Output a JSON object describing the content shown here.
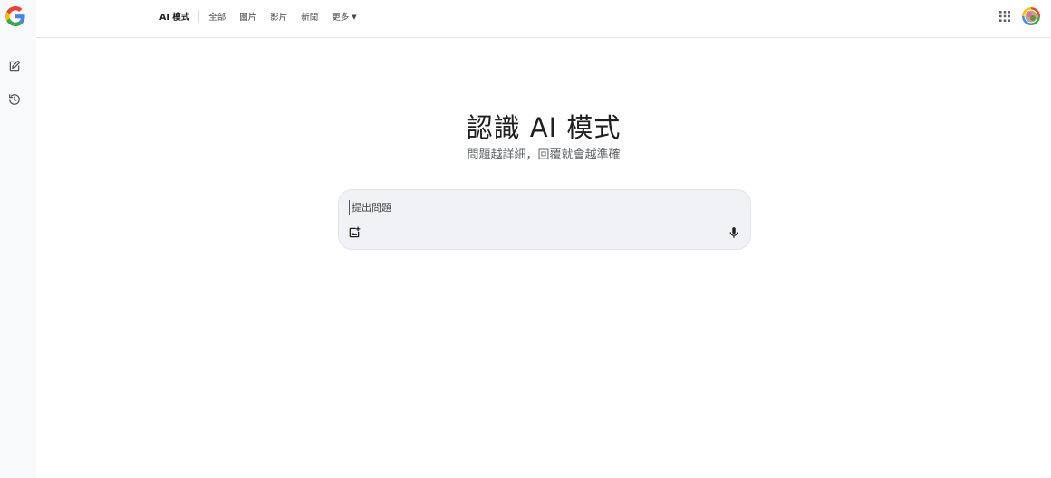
{
  "tabs": [
    {
      "label": "AI 模式",
      "active": true
    },
    {
      "label": "全部"
    },
    {
      "label": "圖片"
    },
    {
      "label": "影片"
    },
    {
      "label": "新聞"
    },
    {
      "label": "更多",
      "has_dropdown": true
    }
  ],
  "hero": {
    "title": "認識 AI 模式",
    "subtitle": "問題越詳細，回覆就會越準確"
  },
  "search": {
    "placeholder": "提出問題",
    "value": ""
  },
  "icons": {
    "logo": "google-g-logo",
    "rail": [
      "new-chat-edit-icon",
      "history-icon"
    ],
    "header": [
      "apps-grid-icon",
      "account-avatar"
    ],
    "search": [
      "image-upload-icon",
      "mic-icon"
    ]
  },
  "colors": {
    "google_blue": "#4285F4",
    "google_red": "#EA4335",
    "google_yellow": "#FBBC05",
    "google_green": "#34A853",
    "search_bg": "#f0f2f5",
    "cursor_green": "#188038"
  }
}
